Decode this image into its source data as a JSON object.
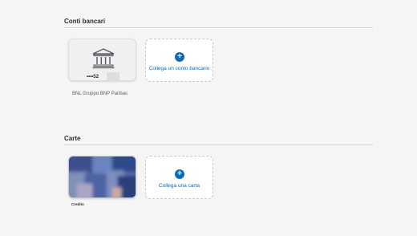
{
  "bank_section": {
    "title": "Conti bancari",
    "account": {
      "masked_number": "••••52",
      "bank_name": "BNL Gruppo BNP Paribas",
      "icon": "bank-icon"
    },
    "add_label": "Collega un conto bancario",
    "add_icon": "plus-icon"
  },
  "card_section": {
    "title": "Carte",
    "card": {
      "caption": "Credito"
    },
    "add_label": "Collega una carta",
    "add_icon": "plus-icon"
  },
  "colors": {
    "accent": "#0f6ab4",
    "background": "#f5f5f6"
  }
}
